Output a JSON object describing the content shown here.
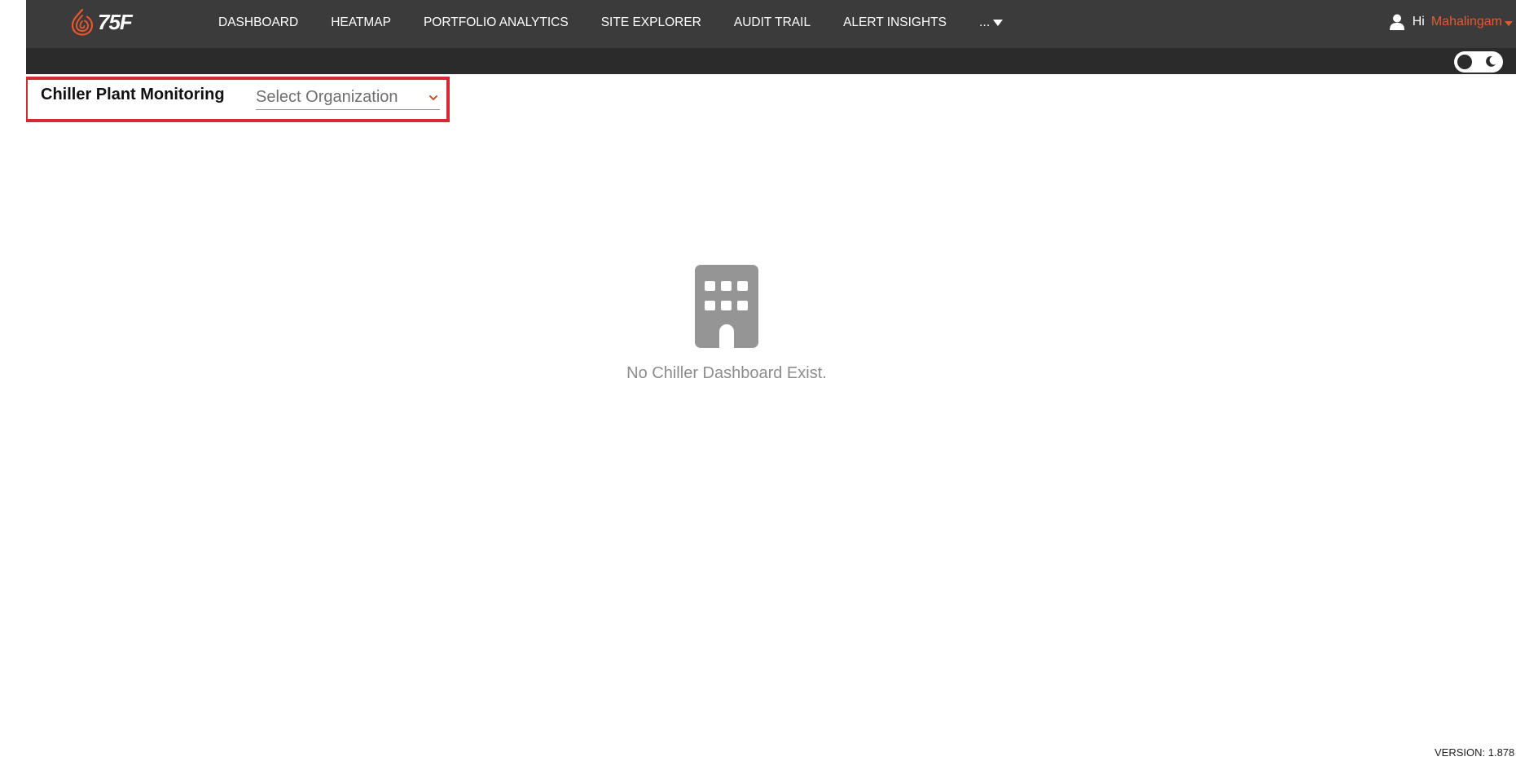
{
  "brand": {
    "logo_text": "75F",
    "accent_color": "#e8572e"
  },
  "nav": {
    "items": [
      {
        "label": "DASHBOARD"
      },
      {
        "label": "HEATMAP"
      },
      {
        "label": "PORTFOLIO ANALYTICS"
      },
      {
        "label": "SITE EXPLORER"
      },
      {
        "label": "AUDIT TRAIL"
      },
      {
        "label": "ALERT INSIGHTS"
      }
    ],
    "more_label": "..."
  },
  "user": {
    "greeting": "Hi",
    "name": "Mahalingam",
    "icon": "user-icon"
  },
  "theme_toggle": {
    "icon": "moon-icon",
    "dark_mode": false
  },
  "page": {
    "title": "Chiller Plant Monitoring",
    "org_select": {
      "placeholder": "Select Organization",
      "icon": "chevron-down-icon"
    },
    "highlight_color": "#d42a35"
  },
  "empty_state": {
    "icon": "building-icon",
    "message": "No Chiller Dashboard Exist."
  },
  "footer": {
    "version": "VERSION: 1.878"
  }
}
